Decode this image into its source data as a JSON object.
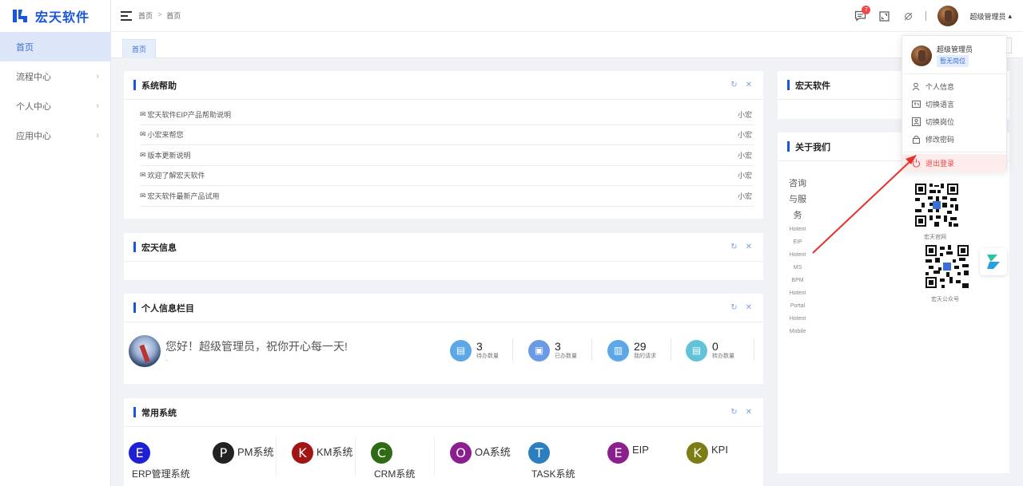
{
  "app": {
    "name": "宏天软件"
  },
  "sidebar": {
    "items": [
      {
        "label": "首页",
        "active": true,
        "has_children": false
      },
      {
        "label": "流程中心",
        "active": false,
        "has_children": true
      },
      {
        "label": "个人中心",
        "active": false,
        "has_children": true
      },
      {
        "label": "应用中心",
        "active": false,
        "has_children": true
      }
    ]
  },
  "header": {
    "breadcrumb": [
      "首页",
      "首页"
    ],
    "breadcrumb_separator": ">",
    "notification_count": "7",
    "user_name": "超级管理员"
  },
  "tabs": [
    {
      "label": "首页"
    }
  ],
  "help_panel": {
    "title": "系统帮助",
    "rows": [
      {
        "title": "宏天软件EIP产品帮助说明",
        "author": "小宏"
      },
      {
        "title": "小宏来帮您",
        "author": "小宏"
      },
      {
        "title": "版本更新说明",
        "author": "小宏"
      },
      {
        "title": "欢迎了解宏天软件",
        "author": "小宏"
      },
      {
        "title": "宏天软件最新产品试用",
        "author": "小宏"
      }
    ]
  },
  "info_panel": {
    "title": "宏天信息"
  },
  "personal_panel": {
    "title": "个人信息栏目",
    "greeting": "您好！超级管理员，祝你开心每一天!",
    "sub": "-",
    "stats": [
      {
        "value": "3",
        "label": "待办数量",
        "color": "#5ba7e8"
      },
      {
        "value": "3",
        "label": "已办数量",
        "color": "#6a9ae6"
      },
      {
        "value": "29",
        "label": "我的请求",
        "color": "#5ba7e8"
      },
      {
        "value": "0",
        "label": "转办数量",
        "color": "#62c2d8"
      }
    ]
  },
  "systems_panel": {
    "title": "常用系统",
    "items": [
      {
        "letter": "E",
        "name": "",
        "name2": "ERP管理系统",
        "color": "#1f1fd6"
      },
      {
        "letter": "P",
        "name": "PM系统",
        "name2": "",
        "color": "#222222"
      },
      {
        "letter": "K",
        "name": "KM系统",
        "name2": "",
        "color": "#a31414"
      },
      {
        "letter": "C",
        "name": "",
        "name2": "CRM系统",
        "color": "#2f6b15"
      },
      {
        "letter": "O",
        "name": "OA系统",
        "name2": "",
        "color": "#8b1f8f"
      },
      {
        "letter": "T",
        "name": "",
        "name2": "TASK系统",
        "color": "#2c7fbf"
      },
      {
        "letter": "E",
        "name": "EIP",
        "name2": "",
        "color": "#8b1f8f"
      },
      {
        "letter": "K",
        "name": "KPI",
        "name2": "",
        "color": "#7d7d15"
      }
    ]
  },
  "right_top_panel": {
    "title": "宏天软件"
  },
  "about_panel": {
    "title": "关于我们",
    "lines_big": [
      "咨询",
      "与服",
      "务"
    ],
    "lines_small": [
      "Hotent",
      "EIP",
      "Hotent",
      "MS",
      "BPM",
      "Hotent",
      "Portal",
      "Hotent",
      "Mobile"
    ],
    "qr_captions": [
      "宏天官网",
      "宏天公众号"
    ]
  },
  "user_menu": {
    "name": "超级管理员",
    "role": "暂无岗位",
    "items": [
      {
        "icon": "user-icon",
        "label": "个人信息"
      },
      {
        "icon": "language-icon",
        "label": "切换语言"
      },
      {
        "icon": "switch-post-icon",
        "label": "切换岗位"
      },
      {
        "icon": "lock-icon",
        "label": "修改密码"
      }
    ],
    "logout": "退出登录"
  }
}
